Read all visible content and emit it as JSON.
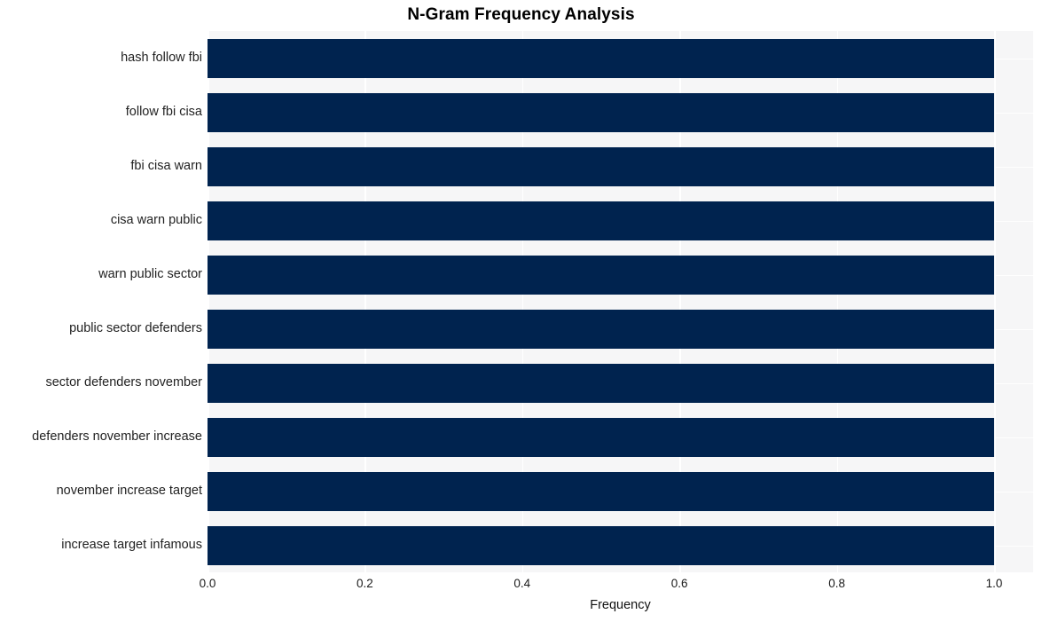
{
  "chart_data": {
    "type": "bar",
    "orientation": "horizontal",
    "title": "N-Gram Frequency Analysis",
    "xlabel": "Frequency",
    "ylabel": "",
    "xlim": [
      0.0,
      1.0
    ],
    "xticks": [
      "0.0",
      "0.2",
      "0.4",
      "0.6",
      "0.8",
      "1.0"
    ],
    "xtick_values": [
      0.0,
      0.2,
      0.4,
      0.6,
      0.8,
      1.0
    ],
    "grid": true,
    "legend": "none",
    "bar_color": "#00234f",
    "plot_background": "#f6f6f7",
    "gridline_color": "#ffffff",
    "categories": [
      "hash follow fbi",
      "follow fbi cisa",
      "fbi cisa warn",
      "cisa warn public",
      "warn public sector",
      "public sector defenders",
      "sector defenders november",
      "defenders november increase",
      "november increase target",
      "increase target infamous"
    ],
    "values": [
      1.0,
      1.0,
      1.0,
      1.0,
      1.0,
      1.0,
      1.0,
      1.0,
      1.0,
      1.0
    ]
  }
}
